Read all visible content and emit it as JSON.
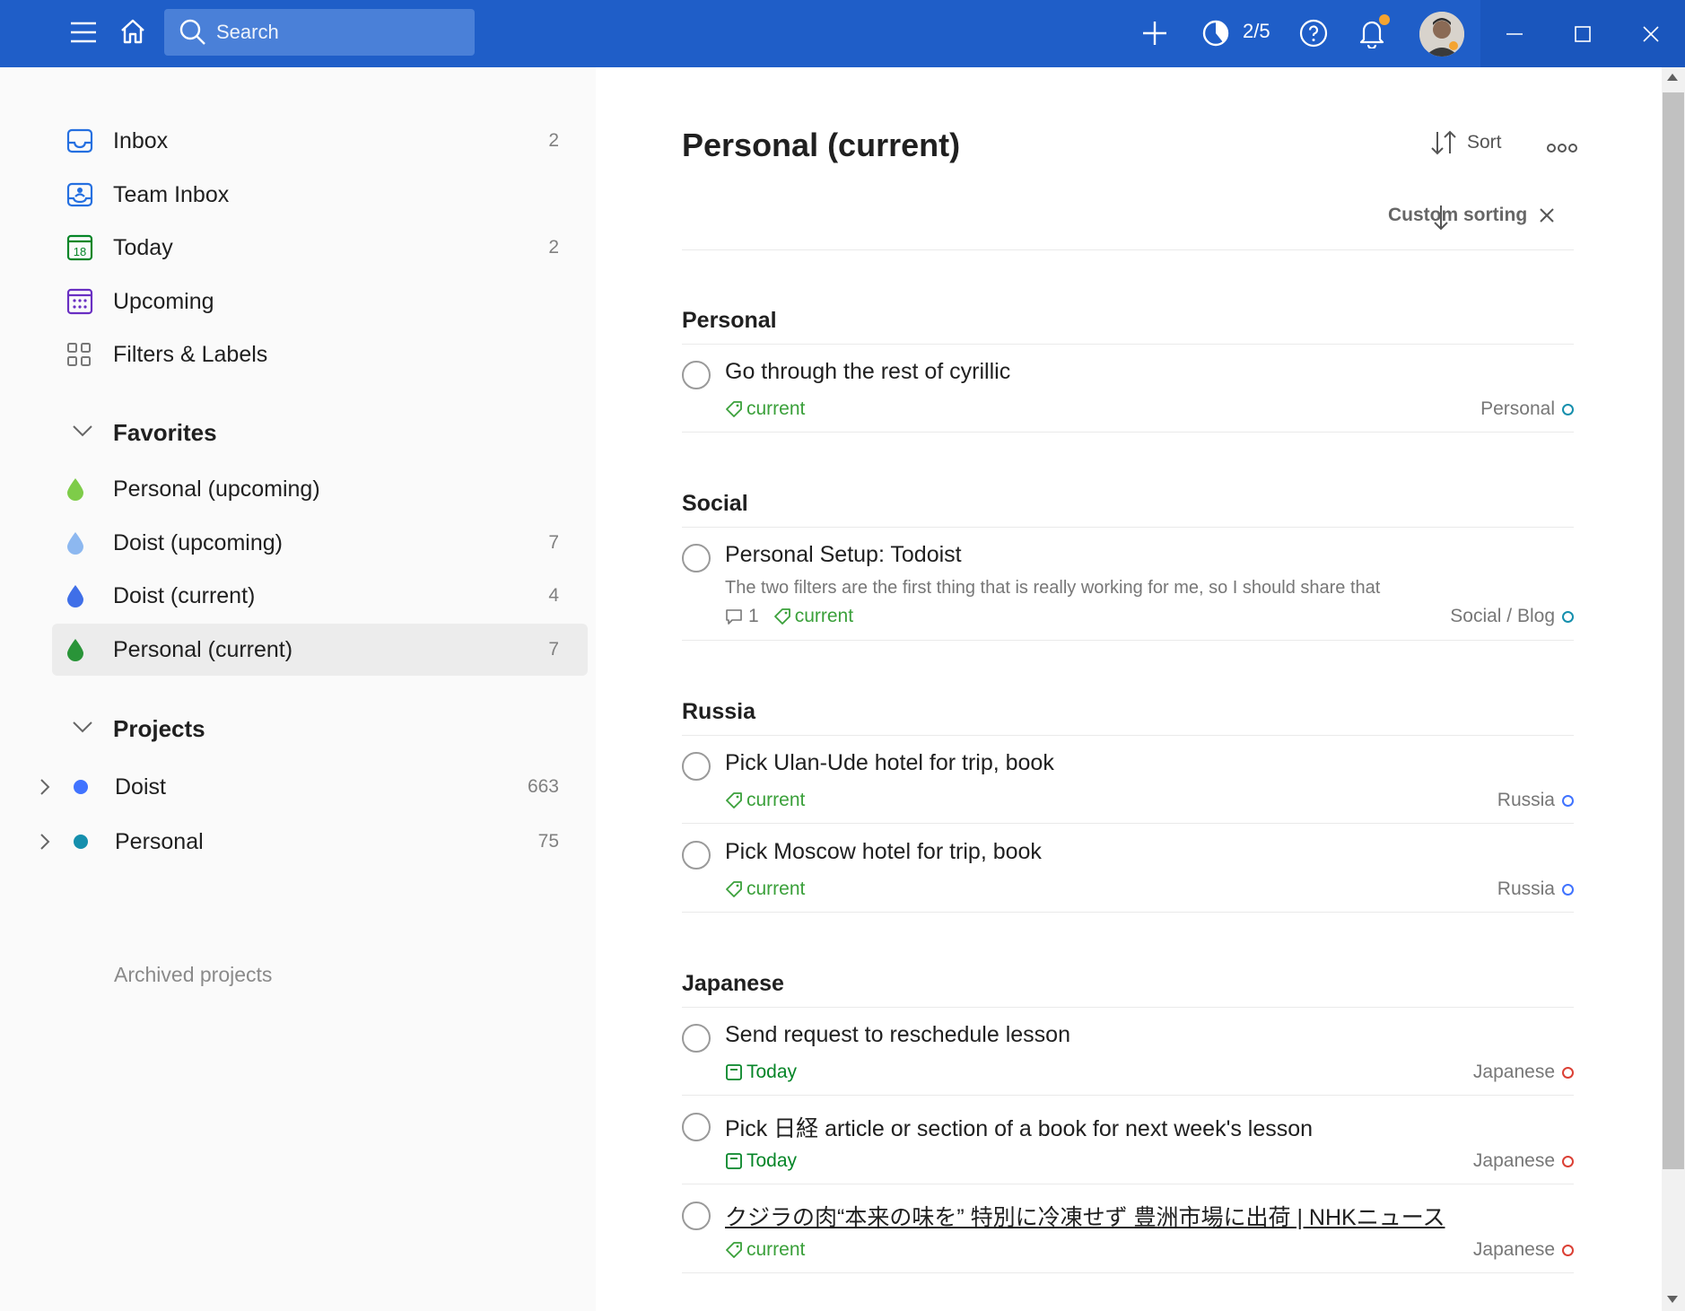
{
  "topbar": {
    "search_placeholder": "Search",
    "karma": "2/5"
  },
  "sidebar": {
    "nav": [
      {
        "label": "Inbox",
        "count": "2"
      },
      {
        "label": "Team Inbox",
        "count": ""
      },
      {
        "label": "Today",
        "count": "2",
        "icon_text": "18"
      },
      {
        "label": "Upcoming",
        "count": ""
      },
      {
        "label": "Filters & Labels",
        "count": ""
      }
    ],
    "favorites_title": "Favorites",
    "favorites": [
      {
        "label": "Personal (upcoming)",
        "count": "",
        "color": "#7ecc49"
      },
      {
        "label": "Doist (upcoming)",
        "count": "7",
        "color": "#8db8f0"
      },
      {
        "label": "Doist (current)",
        "count": "4",
        "color": "#3f6fe8"
      },
      {
        "label": "Personal (current)",
        "count": "7",
        "color": "#299438"
      }
    ],
    "projects_title": "Projects",
    "projects": [
      {
        "label": "Doist",
        "count": "663",
        "color": "#4073ff"
      },
      {
        "label": "Personal",
        "count": "75",
        "color": "#158fad"
      }
    ],
    "archived_label": "Archived projects"
  },
  "main": {
    "title": "Personal (current)",
    "sort_label": "Sort",
    "custom_sorting_label": "Custom sorting",
    "sections": [
      {
        "title": "Personal",
        "tasks": [
          {
            "title": "Go through the rest of cyrillic",
            "label": "current",
            "project": "Personal",
            "project_color": "#158fad"
          }
        ]
      },
      {
        "title": "Social",
        "tasks": [
          {
            "title": "Personal Setup: Todoist",
            "description": "The two filters are the first thing that is really working for me, so I should share that",
            "comments": "1",
            "label": "current",
            "project": "Social / Blog",
            "project_color": "#158fad"
          }
        ]
      },
      {
        "title": "Russia",
        "tasks": [
          {
            "title": "Pick Ulan-Ude hotel for trip, book",
            "label": "current",
            "project": "Russia",
            "project_color": "#4073ff"
          },
          {
            "title": "Pick Moscow hotel for trip, book",
            "label": "current",
            "project": "Russia",
            "project_color": "#4073ff"
          }
        ]
      },
      {
        "title": "Japanese",
        "tasks": [
          {
            "title": "Send request to reschedule lesson",
            "due": "Today",
            "project": "Japanese",
            "project_color": "#db4035"
          },
          {
            "title": "Pick 日経 article or section of a book for next week's lesson",
            "due": "Today",
            "project": "Japanese",
            "project_color": "#db4035"
          },
          {
            "title": "クジラの肉“本来の味を” 特別に冷凍せず 豊洲市場に出荷 | NHKニュース",
            "label": "current",
            "project": "Japanese",
            "project_color": "#db4035"
          }
        ]
      }
    ]
  },
  "colors": {
    "topbar": "#1f5ec8",
    "label_green": "#3aa03a",
    "today_green": "#058527"
  }
}
